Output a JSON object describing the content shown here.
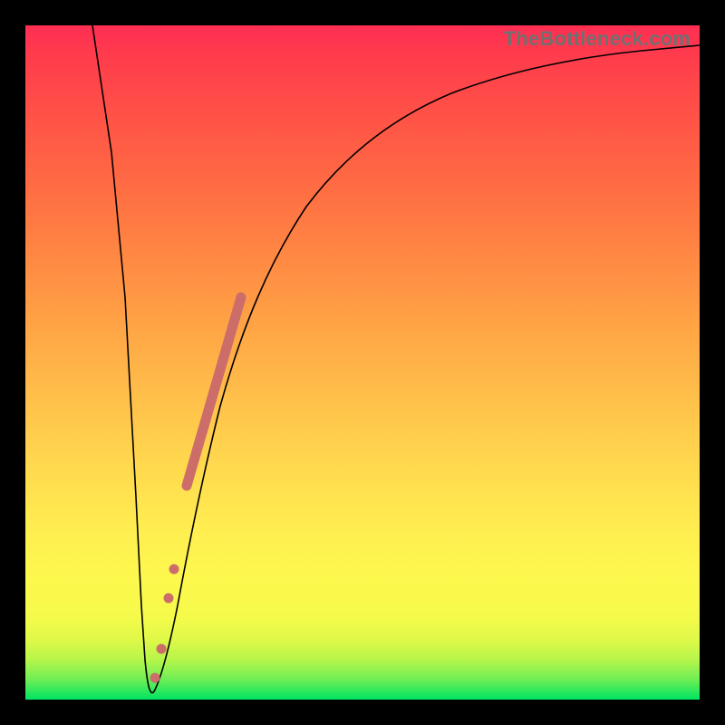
{
  "watermark": "TheBottleneck.com",
  "chart_data": {
    "type": "line",
    "title": "",
    "xlabel": "",
    "ylabel": "",
    "xlim": [
      0,
      100
    ],
    "ylim": [
      0,
      100
    ],
    "series": [
      {
        "name": "bottleneck-curve",
        "x": [
          10,
          12,
          14,
          16,
          17,
          18,
          20,
          22,
          25,
          28,
          32,
          38,
          45,
          55,
          70,
          85,
          100
        ],
        "y": [
          100,
          65,
          30,
          5,
          0,
          3,
          12,
          25,
          40,
          52,
          62,
          72,
          79,
          85,
          90,
          93,
          95
        ]
      }
    ],
    "highlight_segment": {
      "name": "marker-band",
      "x": [
        23,
        31
      ],
      "y": [
        32,
        60
      ]
    },
    "highlight_points": [
      {
        "x": 19.5,
        "y": 10
      },
      {
        "x": 20.5,
        "y": 15
      },
      {
        "x": 17.7,
        "y": 2
      }
    ],
    "gradient_stops": [
      {
        "pos": 0,
        "color": "#00e463"
      },
      {
        "pos": 12,
        "color": "#f4fa4a"
      },
      {
        "pos": 45,
        "color": "#ffbf4a"
      },
      {
        "pos": 75,
        "color": "#ff6f43"
      },
      {
        "pos": 100,
        "color": "#ff2e53"
      }
    ]
  }
}
